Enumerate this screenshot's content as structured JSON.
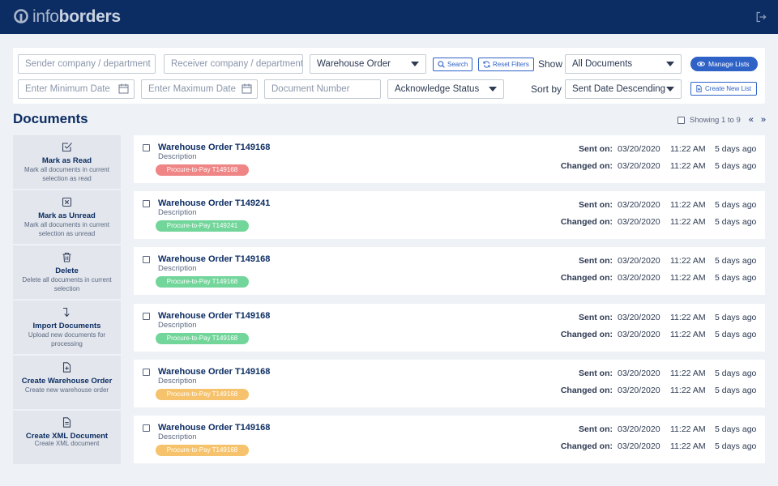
{
  "header": {
    "logo_prefix": "info",
    "logo_suffix": "borders",
    "colors": {
      "bar": "#0c2d63",
      "accent": "#2f62c7"
    }
  },
  "filters": {
    "sender": {
      "placeholder": "Sender company / department"
    },
    "receiver": {
      "placeholder": "Receiver company / department"
    },
    "doc_type": {
      "value": "Warehouse Order"
    },
    "search_label": "Search",
    "reset_label": "Reset Filters",
    "show_label": "Show",
    "show_value": "All Documents",
    "manage_lists_label": "Manage Lists",
    "min_date": {
      "placeholder": "Enter Minimum Date"
    },
    "max_date": {
      "placeholder": "Enter Maximum Date"
    },
    "doc_number": {
      "placeholder": "Document Number"
    },
    "ack_status": {
      "value": "Acknowledge Status"
    },
    "sort_label": "Sort by",
    "sort_value": "Sent Date Descending",
    "create_list_label": "Create New List"
  },
  "main": {
    "title": "Documents",
    "showing": "Showing 1 to 9",
    "prev": "«",
    "next": "»"
  },
  "actions": [
    {
      "icon": "check-square-icon",
      "title": "Mark as Read",
      "desc": "Mark all documents in current selection as read"
    },
    {
      "icon": "x-square-icon",
      "title": "Mark as Unread",
      "desc": "Mark all documents in current selection as unread"
    },
    {
      "icon": "trash-icon",
      "title": "Delete",
      "desc": "Delete all documents in current selection"
    },
    {
      "icon": "arrow-down-right-icon",
      "title": "Import Documents",
      "desc": "Upload new documents for processing"
    },
    {
      "icon": "file-plus-icon",
      "title": "Create Warehouse Order",
      "desc": "Create new warehouse order"
    },
    {
      "icon": "file-text-icon",
      "title": "Create XML Document",
      "desc": "Create XML document"
    }
  ],
  "tag_colors": {
    "red": "#ef8585",
    "green": "#72d59a",
    "orange": "#f6c26b"
  },
  "documents": [
    {
      "title": "Warehouse Order T149168",
      "desc": "Description",
      "tag": "Procure-to-Pay T149168",
      "tag_color": "red",
      "sent_label": "Sent on:",
      "sent_date": "03/20/2020",
      "sent_time": "11:22 AM",
      "sent_ago": "5 days ago",
      "changed_label": "Changed on:",
      "changed_date": "03/20/2020",
      "changed_time": "11:22 AM",
      "changed_ago": "5 days ago"
    },
    {
      "title": "Warehouse Order T149241",
      "desc": "Description",
      "tag": "Procure-to-Pay T149241",
      "tag_color": "green",
      "sent_label": "Sent on:",
      "sent_date": "03/20/2020",
      "sent_time": "11:22 AM",
      "sent_ago": "5 days ago",
      "changed_label": "Changed on:",
      "changed_date": "03/20/2020",
      "changed_time": "11:22 AM",
      "changed_ago": "5 days ago"
    },
    {
      "title": "Warehouse Order T149168",
      "desc": "Description",
      "tag": "Procure-to-Pay T149168",
      "tag_color": "green",
      "sent_label": "Sent on:",
      "sent_date": "03/20/2020",
      "sent_time": "11:22 AM",
      "sent_ago": "5 days ago",
      "changed_label": "Changed on:",
      "changed_date": "03/20/2020",
      "changed_time": "11:22 AM",
      "changed_ago": "5 days ago"
    },
    {
      "title": "Warehouse Order T149168",
      "desc": "Description",
      "tag": "Procure-to-Pay T149168",
      "tag_color": "green",
      "sent_label": "Sent on:",
      "sent_date": "03/20/2020",
      "sent_time": "11:22 AM",
      "sent_ago": "5 days ago",
      "changed_label": "Changed on:",
      "changed_date": "03/20/2020",
      "changed_time": "11:22 AM",
      "changed_ago": "5 days ago"
    },
    {
      "title": "Warehouse Order T149168",
      "desc": "Description",
      "tag": "Procure-to-Pay T149168",
      "tag_color": "orange",
      "sent_label": "Sent on:",
      "sent_date": "03/20/2020",
      "sent_time": "11:22 AM",
      "sent_ago": "5 days ago",
      "changed_label": "Changed on:",
      "changed_date": "03/20/2020",
      "changed_time": "11:22 AM",
      "changed_ago": "5 days ago"
    },
    {
      "title": "Warehouse Order T149168",
      "desc": "Description",
      "tag": "Procure-to-Pay T149168",
      "tag_color": "orange",
      "sent_label": "Sent on:",
      "sent_date": "03/20/2020",
      "sent_time": "11:22 AM",
      "sent_ago": "5 days ago",
      "changed_label": "Changed on:",
      "changed_date": "03/20/2020",
      "changed_time": "11:22 AM",
      "changed_ago": "5 days ago"
    }
  ]
}
